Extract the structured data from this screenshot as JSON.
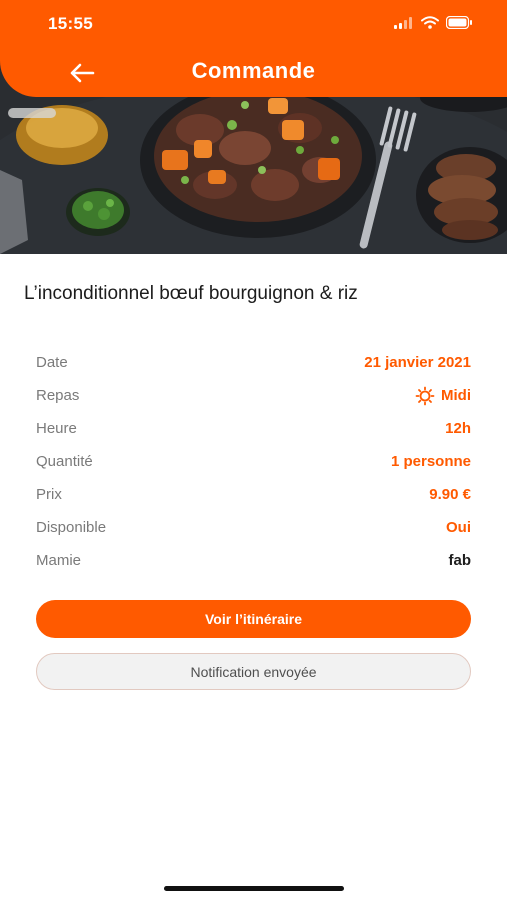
{
  "status_bar": {
    "time": "15:55"
  },
  "header": {
    "title": "Commande",
    "back_icon": "arrow-left-icon"
  },
  "hero": {
    "image": "dish-photo-boeuf-bourguignon"
  },
  "dish": {
    "title": "L’inconditionnel bœuf bourguignon & riz"
  },
  "details": [
    {
      "label": "Date",
      "value": "21 janvier 2021"
    },
    {
      "label": "Repas",
      "value": "Midi",
      "icon": "sun-icon"
    },
    {
      "label": "Heure",
      "value": "12h"
    },
    {
      "label": "Quantité",
      "value": "1 personne"
    },
    {
      "label": "Prix",
      "value": "9.90 €"
    },
    {
      "label": "Disponible",
      "value": "Oui"
    },
    {
      "label": "Mamie",
      "value": "fab"
    }
  ],
  "actions": {
    "primary_label": "Voir l’itinéraire",
    "secondary_label": "Notification envoyée"
  },
  "colors": {
    "accent": "#ff5a00",
    "label": "#7a7a7a",
    "text": "#1c1c1c"
  }
}
